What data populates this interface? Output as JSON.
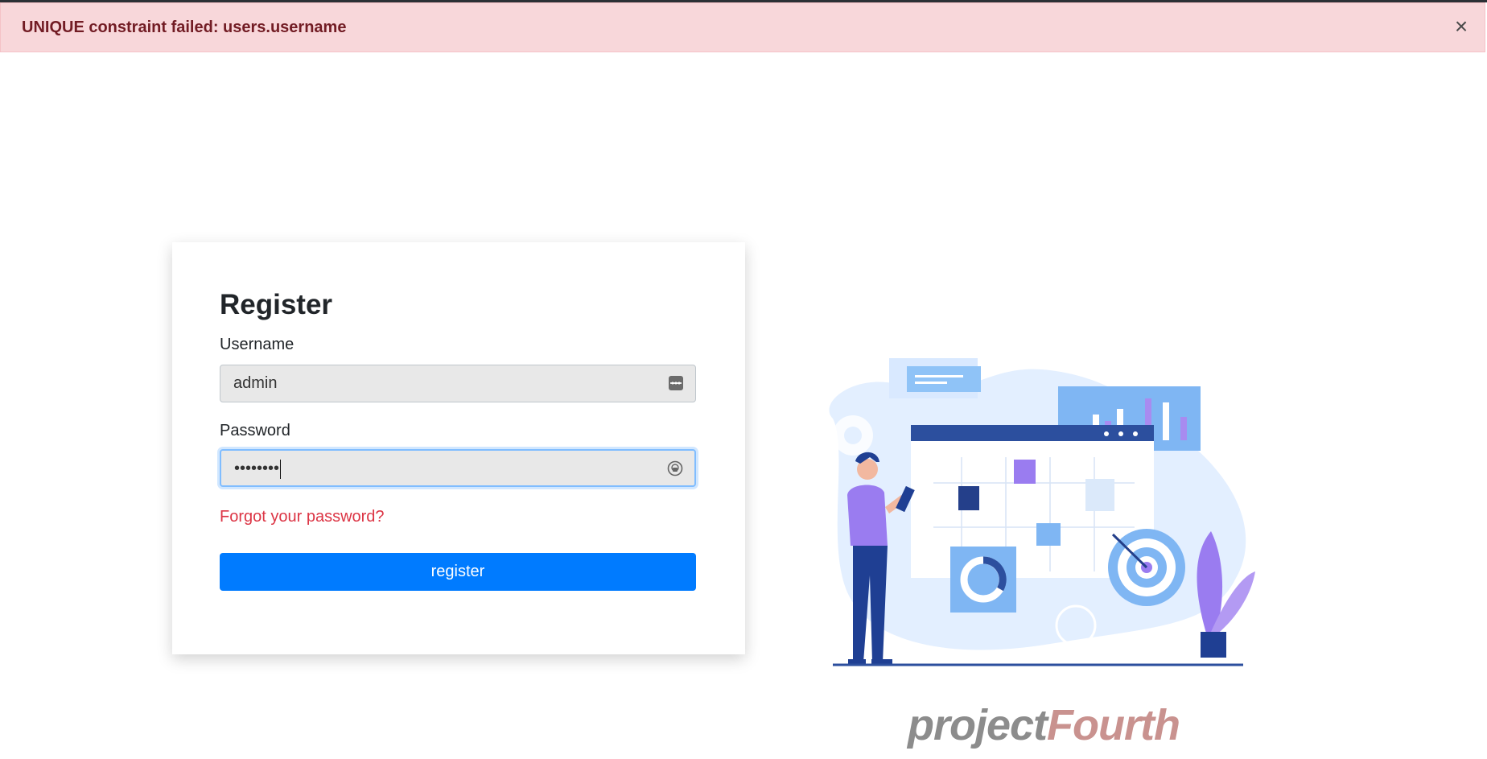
{
  "alert": {
    "message": "UNIQUE constraint failed: users.username",
    "close_label": "×",
    "color": "#f8d7da"
  },
  "form": {
    "title": "Register",
    "username_label": "Username",
    "username_value": "admin",
    "password_label": "Password",
    "password_value": "••••••••",
    "forgot_link": "Forgot your password?",
    "submit_label": "register",
    "accent": "#007bff"
  },
  "brand": {
    "part1": "project",
    "part2": "Fourth"
  },
  "icons": {
    "username_field": "autofill-key-icon",
    "password_field": "password-manager-icon",
    "illustration": "calendar-planning-illustration"
  }
}
